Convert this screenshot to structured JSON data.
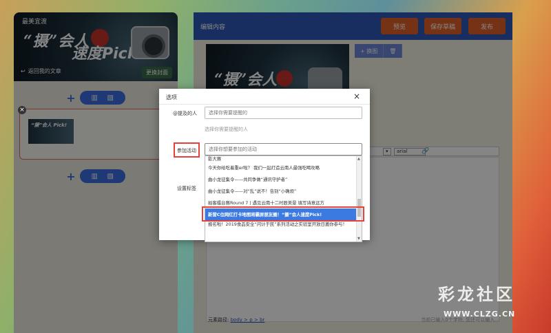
{
  "left_panel": {
    "site_name": "最美宜渡",
    "cover_title_a": "“摄”会人",
    "cover_title_b": "速度Pick!",
    "back_label": "返回我的文章",
    "change_cover_label": "更换封面",
    "card_thumb_text": "“摄”会人 Pick!"
  },
  "editor": {
    "header_title": "编辑内容",
    "preview_label": "预览",
    "save_draft_label": "保存草稿",
    "publish_label": "发布",
    "poster_title": "“摄”会人",
    "poster_cut_text": "Pick!",
    "replace_image_label": "+ 换图",
    "delete_icon": "🗑",
    "font_select": "arial",
    "path_label": "元素路径:",
    "path_links": "body > p > br",
    "word_count_text": "当前已输入0个字符, 您还可以输入..."
  },
  "modal": {
    "title": "选项",
    "close": "×",
    "mention_label": "@提及的人",
    "mention_placeholder": "选择你需要提醒的",
    "mention_hint": "选择你需要提醒的人",
    "activity_label": "参加活动",
    "activity_placeholder": "选择你想要参加的活动",
    "tag_label": "设置标签",
    "activity_options": [
      "影大赛",
      "今天你给吃着重er啦？ 我们一起打造云南人最强吃喝攻略",
      "曲小龙征集令——共同争做“通讯守护者”",
      "曲小龙征集令——对“乱”说不！告别“小确烦”",
      "拍客擂台赛Round 7丨遇见云南十二时辰美景 填写诗意远方",
      "新营C位网红打卡地图将霸屏朋友圈！“摄”会人速度Pick!",
      "报名啦！2019食品安全“问计于民”系列活动之实验室开放日邀你参与！"
    ]
  },
  "watermark": {
    "brand": "彩龙社区",
    "url": "WWW.CLZG.CN"
  },
  "colors": {
    "header_blue": "#2f57b8",
    "action_orange": "#e2602a",
    "highlight_red": "#e6403a",
    "selected_blue": "#3b7ae0"
  }
}
